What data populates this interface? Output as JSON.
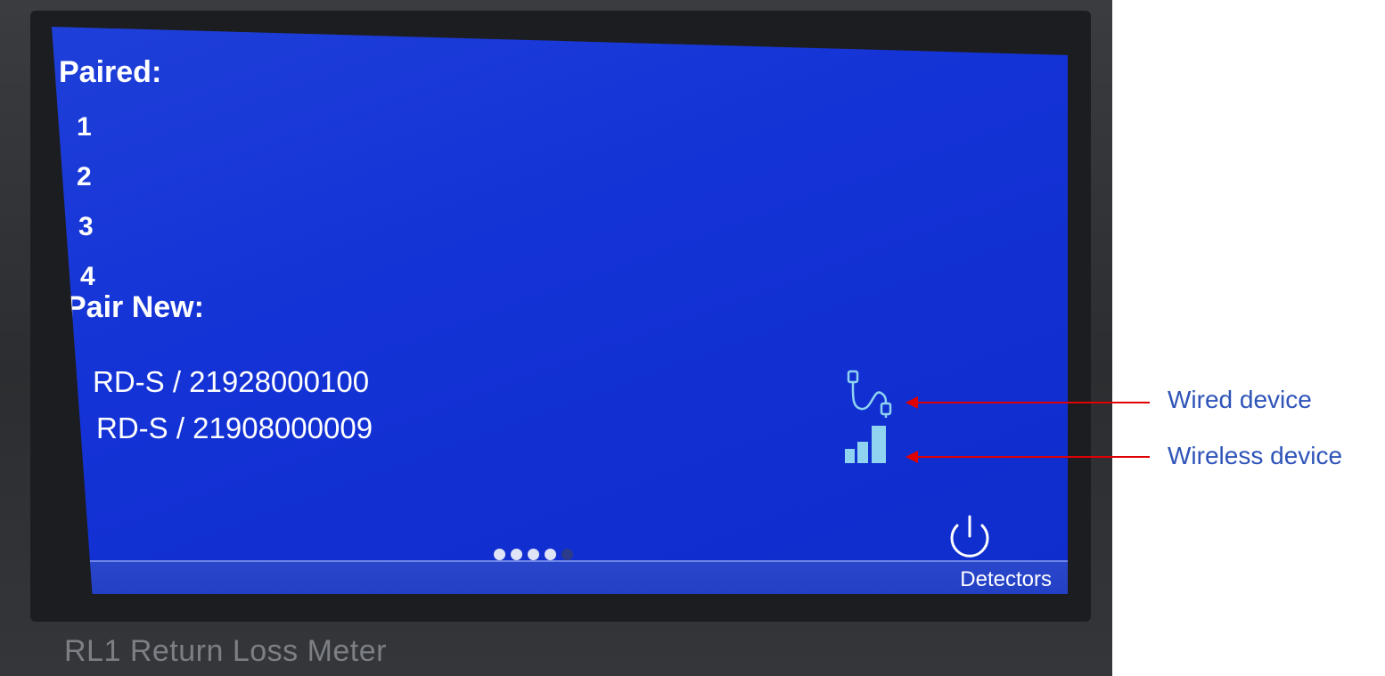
{
  "screen": {
    "paired_title": "Paired:",
    "slots": [
      "1",
      "2",
      "3",
      "4"
    ],
    "pair_new_title": "Pair New:",
    "devices": [
      "RD-S / 21928000100",
      "RD-S / 21908000009"
    ],
    "page_indicator": {
      "total": 5,
      "active_count": 4
    },
    "bottom_label": "Detectors",
    "icons": {
      "wired": "usb-cable-icon",
      "wireless": "signal-bars-icon",
      "power": "power-icon"
    },
    "colors": {
      "screen_bg": "#1433d6",
      "text": "#ffffff",
      "icon": "#8fd3f0"
    }
  },
  "device_label": "RL1 Return Loss Meter",
  "annotations": {
    "wired": "Wired device",
    "wireless": "Wireless device",
    "arrow_color": "#e00000",
    "label_color": "#2e54b8"
  }
}
